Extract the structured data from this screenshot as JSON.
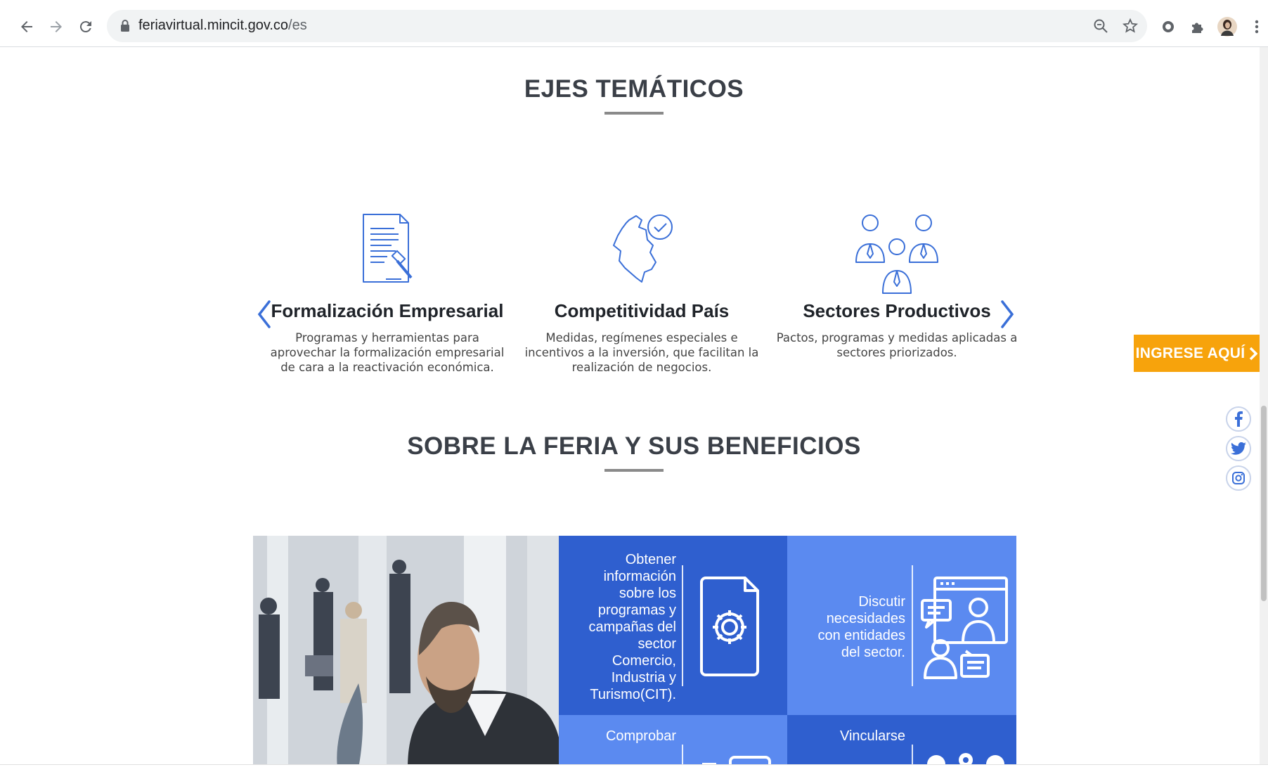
{
  "browser": {
    "url_domain": "feriavirtual.mincit.gov.co",
    "url_path": "/es"
  },
  "ejes": {
    "title": "EJES TEMÁTICOS",
    "items": [
      {
        "title": "Formalización Empresarial",
        "desc_lines": [
          "Programas y herramientas para",
          "aprovechar la formalización empresarial",
          "de cara a la reactivación económica."
        ]
      },
      {
        "title": "Competitividad País",
        "desc_lines": [
          "Medidas, regímenes especiales e",
          "incentivos a la inversión, que facilitan la",
          "realización de negocios."
        ]
      },
      {
        "title": "Sectores Productivos",
        "desc_lines": [
          "Pactos, programas y medidas aplicadas a",
          "sectores priorizados."
        ]
      }
    ]
  },
  "side": {
    "ingrese_label": "INGRESE AQUÍ"
  },
  "beneficios": {
    "title": "SOBRE LA FERIA Y SUS BENEFICIOS",
    "tiles": [
      {
        "lines": [
          "Obtener",
          "información",
          "sobre los",
          "programas y",
          "campañas del",
          "sector",
          "Comercio,",
          "Industria y",
          "Turismo(CIT)."
        ]
      },
      {
        "lines": [
          "Discutir",
          "necesidades",
          "con entidades",
          "del sector."
        ]
      },
      {
        "lines": [
          "Comprobar"
        ]
      },
      {
        "lines": [
          "Vincularse"
        ]
      }
    ]
  },
  "colors": {
    "tile_dark": "#2f5fcf",
    "tile_light": "#5b8af0",
    "accent_orange": "#f7a30c",
    "icon_blue": "#3a6fd8"
  }
}
